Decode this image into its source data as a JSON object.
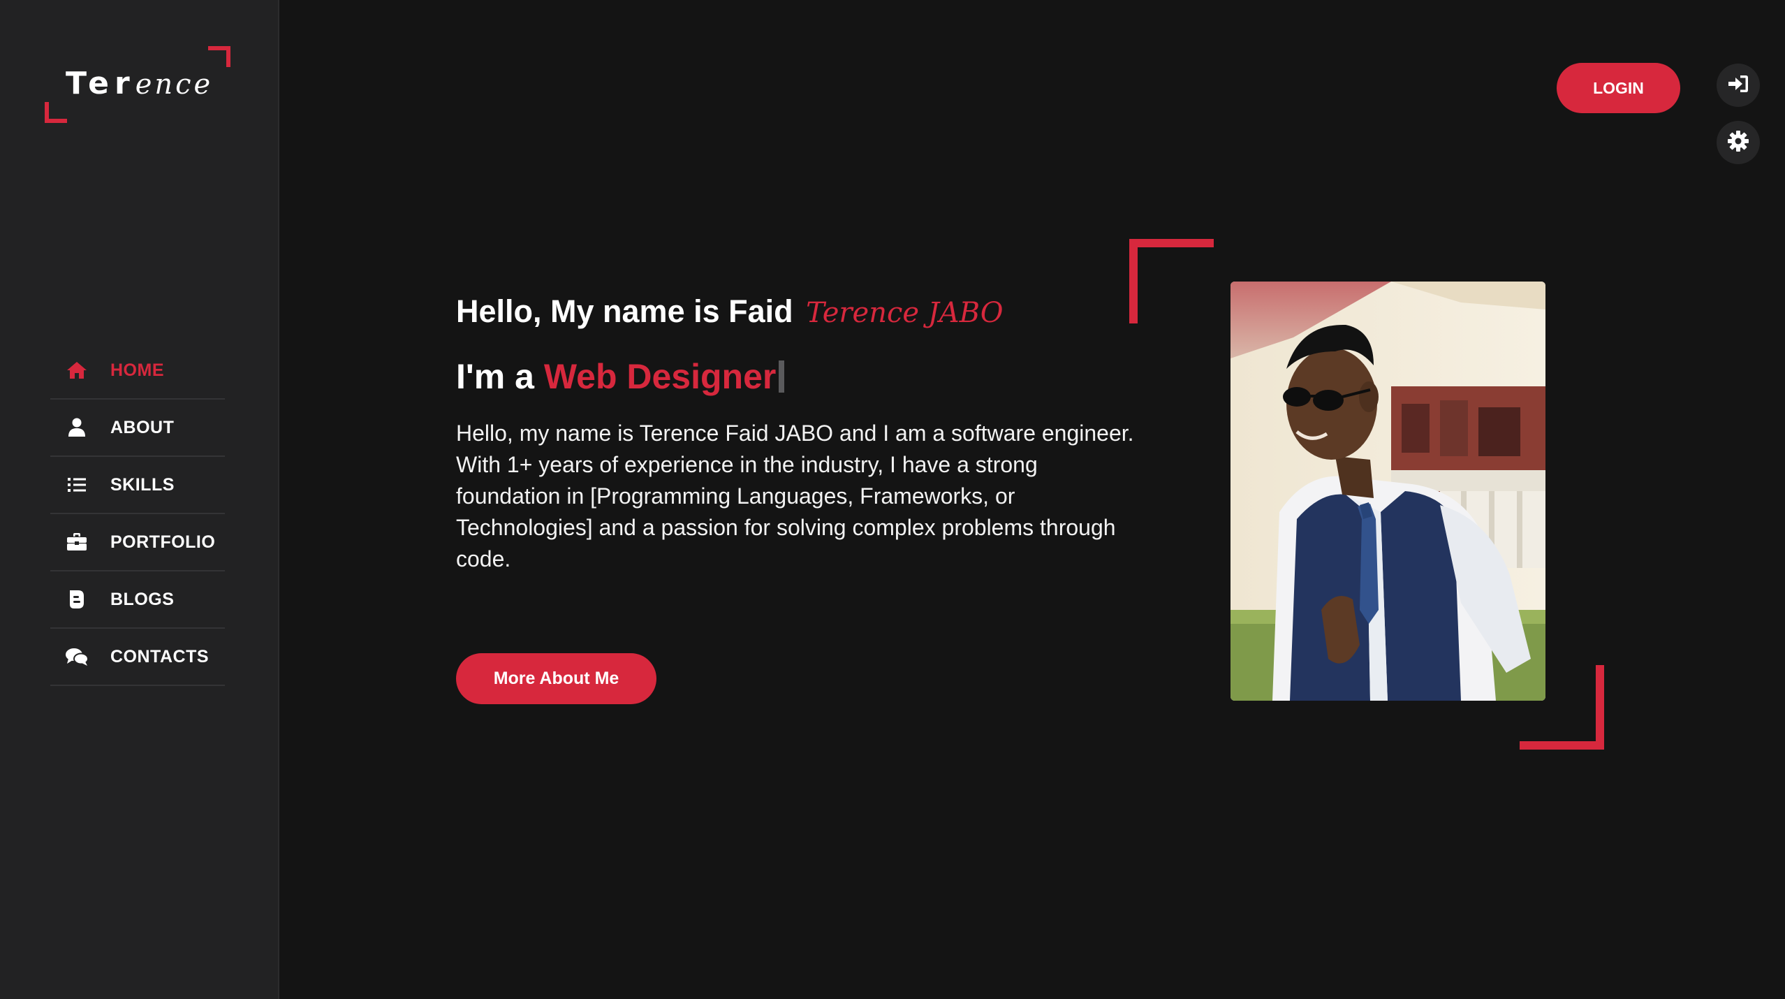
{
  "brand": {
    "logo_plain": "Ter",
    "logo_script": "ence",
    "accent_color": "#d7283d"
  },
  "sidebar": {
    "items": [
      {
        "label": "HOME",
        "icon": "home-icon",
        "active": true
      },
      {
        "label": "ABOUT",
        "icon": "user-icon",
        "active": false
      },
      {
        "label": "SKILLS",
        "icon": "list-icon",
        "active": false
      },
      {
        "label": "PORTFOLIO",
        "icon": "briefcase-icon",
        "active": false
      },
      {
        "label": "BLOGS",
        "icon": "blogger-icon",
        "active": false
      },
      {
        "label": "CONTACTS",
        "icon": "comments-icon",
        "active": false
      }
    ]
  },
  "header": {
    "login_label": "LOGIN",
    "signin_icon": "sign-in-icon",
    "theme_icon": "gear-icon"
  },
  "hero": {
    "greeting": "Hello, My name is Faid",
    "script_name": "Terence JABO",
    "role_prefix": "I'm a",
    "role": "Web Designer",
    "description": "Hello, my name is Terence Faid JABO and I am a software engineer. With 1+ years of experience in the industry, I have a strong foundation in [Programming Languages, Frameworks, or Technologies] and a passion for solving complex problems through code.",
    "cta_label": "More About Me"
  }
}
